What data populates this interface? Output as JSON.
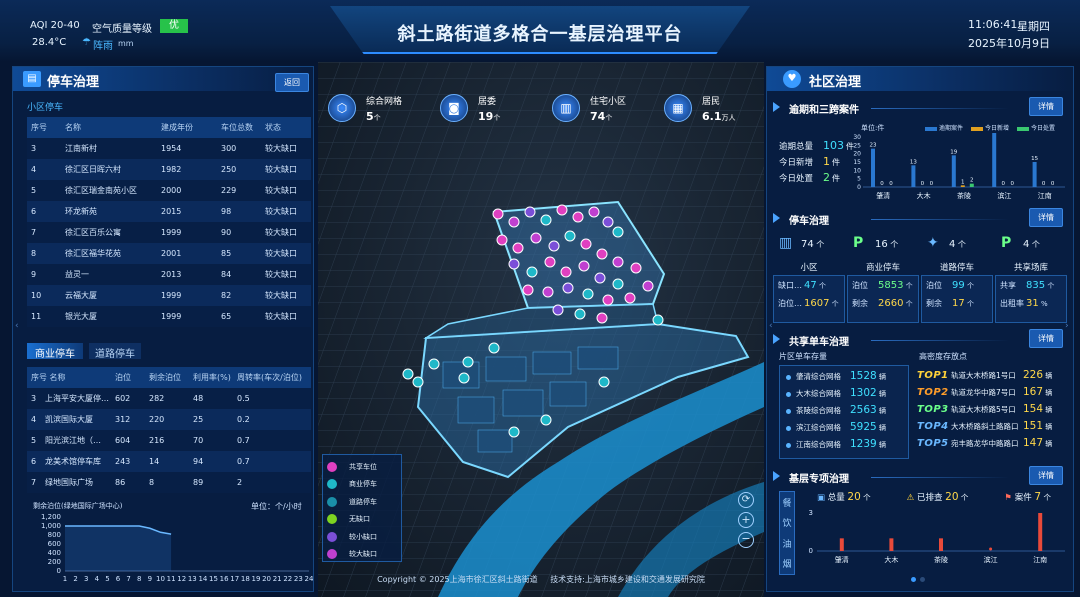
{
  "header": {
    "aqi": "AQI 20-40",
    "air_label": "空气质量等级",
    "air_grade": "优",
    "temp": "28.4°C",
    "weather": "阵雨",
    "unit_mm": "mm",
    "title": "斜土路街道多格合一基层治理平台",
    "time": "11:06:41",
    "weekday": "星期四",
    "date": "2025年10月9日"
  },
  "parking": {
    "title": "停车治理",
    "back": "返回",
    "sub_title": "小区停车",
    "columns": [
      "序号",
      "名称",
      "建成年份",
      "车位总数",
      "状态"
    ],
    "rows": [
      [
        "3",
        "江南新村",
        "1954",
        "300",
        "较大缺口"
      ],
      [
        "4",
        "徐汇区日晖六村",
        "1982",
        "250",
        "较大缺口"
      ],
      [
        "5",
        "徐汇区瑞金南苑小区",
        "2000",
        "229",
        "较大缺口"
      ],
      [
        "6",
        "环龙新苑",
        "2015",
        "98",
        "较大缺口"
      ],
      [
        "7",
        "徐汇区百乐公寓",
        "1999",
        "90",
        "较大缺口"
      ],
      [
        "8",
        "徐汇区福华花苑",
        "2001",
        "85",
        "较大缺口"
      ],
      [
        "9",
        "益灵一",
        "2013",
        "84",
        "较大缺口"
      ],
      [
        "10",
        "云福大厦",
        "1999",
        "82",
        "较大缺口"
      ],
      [
        "11",
        "银光大厦",
        "1999",
        "65",
        "较大缺口"
      ]
    ],
    "tabs": [
      "商业停车",
      "道路停车"
    ],
    "biz_columns": [
      "序号 名称",
      "泊位",
      "剩余泊位",
      "利用率(%)",
      "周转率(车次/泊位)"
    ],
    "biz_rows": [
      [
        "3",
        "上海平安大厦停…",
        "602",
        "282",
        "48",
        "0.5"
      ],
      [
        "4",
        "凯滨国际大厦",
        "312",
        "220",
        "25",
        "0.2"
      ],
      [
        "5",
        "阳光滨江地（…",
        "604",
        "216",
        "70",
        "0.7"
      ],
      [
        "6",
        "龙美术馆停车库",
        "243",
        "14",
        "94",
        "0.7"
      ],
      [
        "7",
        "绿地国际广场",
        "86",
        "8",
        "89",
        "2"
      ]
    ]
  },
  "chart_data": {
    "type": "line",
    "title": "剩余泊位(绿地国际广场中心)",
    "unit": "单位：个/小时",
    "x": [
      1,
      2,
      3,
      4,
      5,
      6,
      7,
      8,
      9,
      10,
      11,
      12,
      13,
      14,
      15,
      16,
      17,
      18,
      19,
      20,
      21,
      22,
      23,
      24
    ],
    "y": [
      1000,
      1000,
      1000,
      1000,
      1000,
      1000,
      1000,
      1000,
      950,
      860,
      820,
      null,
      null,
      null,
      null,
      null,
      null,
      null,
      null,
      null,
      null,
      null,
      null,
      null
    ],
    "yticks": [
      0,
      200,
      400,
      600,
      800,
      1000,
      1200
    ],
    "ylim": [
      0,
      1200
    ]
  },
  "map": {
    "stats": [
      {
        "label": "综合网格",
        "value": "5",
        "unit": "个"
      },
      {
        "label": "居委",
        "value": "19",
        "unit": "个"
      },
      {
        "label": "住宅小区",
        "value": "74",
        "unit": "个"
      },
      {
        "label": "居民",
        "value": "6.1",
        "unit": "万人"
      }
    ],
    "legend": [
      {
        "label": "共享车位",
        "color": "#e040c0"
      },
      {
        "label": "商业停车",
        "color": "#1fb8c8"
      },
      {
        "label": "道路停车",
        "color": "#1a8fa8"
      },
      {
        "label": "无缺口",
        "color": "#7ed321"
      },
      {
        "label": "较小缺口",
        "color": "#7b4fd8"
      },
      {
        "label": "较大缺口",
        "color": "#c040d0"
      }
    ],
    "copyright": "Copyright © 2025上海市徐汇区斜土路街道",
    "support": "技术支持:上海市城乡建设和交通发展研究院"
  },
  "community": {
    "title": "社区治理",
    "overdue": {
      "title": "逾期和三跨案件",
      "detail": "详情",
      "items": [
        {
          "label": "逾期总量",
          "value": "103",
          "unit": "件"
        },
        {
          "label": "今日新增",
          "value": "1",
          "unit": "件"
        },
        {
          "label": "今日处置",
          "value": "2",
          "unit": "件"
        }
      ],
      "unit_label": "单位:件",
      "legend": [
        "逾期案件",
        "今日新增",
        "今日处置"
      ],
      "yticks": [
        "30",
        "25",
        "20",
        "15",
        "10",
        "5",
        "0"
      ],
      "categories": [
        "肇清",
        "大木",
        "茶陵",
        "滨江",
        "江南"
      ],
      "series": [
        {
          "name": "逾期案件",
          "values": [
            23,
            13,
            19,
            33,
            15
          ]
        },
        {
          "name": "今日新增",
          "values": [
            0,
            0,
            1,
            0,
            0
          ]
        },
        {
          "name": "今日处置",
          "values": [
            0,
            0,
            2,
            0,
            0
          ]
        }
      ],
      "labels": [
        [
          "23",
          "0",
          "0"
        ],
        [
          "13",
          "0",
          "0"
        ],
        [
          "19",
          "1",
          "2"
        ],
        [
          "33",
          "0",
          "0"
        ],
        [
          "15",
          "0",
          "0"
        ]
      ]
    },
    "parking": {
      "title": "停车治理",
      "detail": "详情",
      "cards": [
        {
          "value": "74",
          "unit": "个",
          "label": "小区",
          "k1": "缺口…",
          "v1": "47",
          "u1": "个",
          "k2": "泊位…",
          "v2": "1607",
          "u2": "个"
        },
        {
          "value": "16",
          "unit": "个",
          "label": "商业停车",
          "k1": "泊位",
          "v1": "5853",
          "u1": "个",
          "k2": "剩余",
          "v2": "2660",
          "u2": "个"
        },
        {
          "value": "4",
          "unit": "个",
          "label": "道路停车",
          "k1": "泊位",
          "v1": "99",
          "u1": "个",
          "k2": "剩余",
          "v2": "17",
          "u2": "个"
        },
        {
          "value": "4",
          "unit": "个",
          "label": "共享场库",
          "k1": "共享",
          "v1": "835",
          "u1": "个",
          "k2": "出租率",
          "v2": "31",
          "u2": "%"
        }
      ]
    },
    "bike": {
      "title": "共享单车治理",
      "detail": "详情",
      "left_title": "片区单车存量",
      "right_title": "高密度存放点",
      "areas": [
        {
          "name": "肇清综合网格",
          "value": "1528",
          "unit": "辆"
        },
        {
          "name": "大木综合网格",
          "value": "1302",
          "unit": "辆"
        },
        {
          "name": "茶陵综合网格",
          "value": "2563",
          "unit": "辆"
        },
        {
          "name": "滨江综合网格",
          "value": "5925",
          "unit": "辆"
        },
        {
          "name": "江南综合网格",
          "value": "1239",
          "unit": "辆"
        }
      ],
      "tops": [
        {
          "rank": "TOP1",
          "name": "轨道大木桥路1号口",
          "value": "226",
          "unit": "辆"
        },
        {
          "rank": "TOP2",
          "name": "轨道龙华中路7号口",
          "value": "167",
          "unit": "辆"
        },
        {
          "rank": "TOP3",
          "name": "轨道大木桥路5号口",
          "value": "154",
          "unit": "辆"
        },
        {
          "rank": "TOP4",
          "name": "大木桥路斜土路路口",
          "value": "151",
          "unit": "辆"
        },
        {
          "rank": "TOP5",
          "name": "宛丰路龙华中路路口",
          "value": "147",
          "unit": "辆"
        }
      ]
    },
    "special": {
      "title": "基层专项治理",
      "detail": "详情",
      "side_label": [
        "餐",
        "饮",
        "油",
        "烟"
      ],
      "items": [
        {
          "label": "总量",
          "value": "20",
          "unit": "个"
        },
        {
          "label": "已排查",
          "value": "20",
          "unit": "个"
        },
        {
          "label": "案件",
          "value": "7",
          "unit": "个"
        }
      ],
      "yticks": [
        "3",
        "0"
      ],
      "categories": [
        "肇清",
        "大木",
        "茶陵",
        "滨江",
        "江南"
      ],
      "values": [
        1,
        1,
        1,
        0,
        3
      ]
    }
  }
}
